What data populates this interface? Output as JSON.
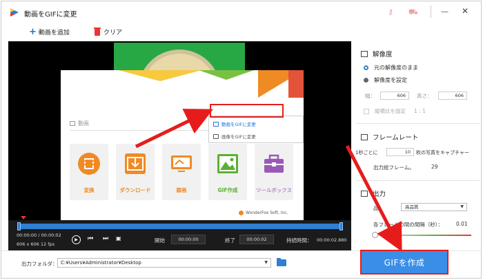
{
  "window": {
    "title": "動画をGIFに変更",
    "minimize": "—",
    "close": "✕"
  },
  "toolbar": {
    "add_video": "動画を追加",
    "clear": "クリア"
  },
  "preview": {
    "section_label": "動画",
    "tiles": [
      {
        "label": "変換",
        "icon": "convert-icon"
      },
      {
        "label": "ダウンロード",
        "icon": "download-icon"
      },
      {
        "label": "録画",
        "icon": "screen-record-icon"
      },
      {
        "label": "GIF作成",
        "icon": "image-icon"
      },
      {
        "label": "ツールボックス",
        "icon": "toolbox-icon"
      }
    ],
    "popup": {
      "item1": "動画をGIFに変更",
      "item2": "画像をGIFに変更"
    },
    "brand": "WonderFox Soft, Inc.",
    "colors": {
      "orange": "#f08a24",
      "green": "#5cb030",
      "purple": "#9b59b6",
      "highlight": "#e61c1c"
    }
  },
  "player": {
    "time": "00:00:00 / 00:00:02",
    "dims": "606 x 606    12 fps",
    "start_label": "開始",
    "start_value": "00:00:00",
    "end_label": "終了",
    "end_value": "00:00:02",
    "duration_label": "持続時間：",
    "duration_value": "00:00:02.880"
  },
  "panel": {
    "resolution_title": "解像度",
    "keep_original": "元の解像度のまま",
    "set_resolution": "解像度を設定",
    "width_label": "幅：",
    "width_value": "606",
    "height_label": "高さ：",
    "height_value": "606",
    "keep_ratio": "縦横比を固定",
    "ratio": "1 : 1",
    "framerate_title": "フレームレート",
    "fr_prefix": "1秒ごとに",
    "fr_value": "10",
    "fr_suffix": "枚の写真をキャプチャー",
    "total_frames_label": "出力総フレーム。",
    "total_frames_value": "29",
    "output_title": "出力",
    "quality_label": "品",
    "quality_value": "高品質",
    "interval_label": "各フレームの間の間隔（秒）：",
    "interval_value": "0.01"
  },
  "bottom": {
    "output_folder_label": "出力フォルダ：",
    "output_path": "C:¥Users¥Administrator¥Desktop",
    "create_gif": "GIFを作成"
  }
}
